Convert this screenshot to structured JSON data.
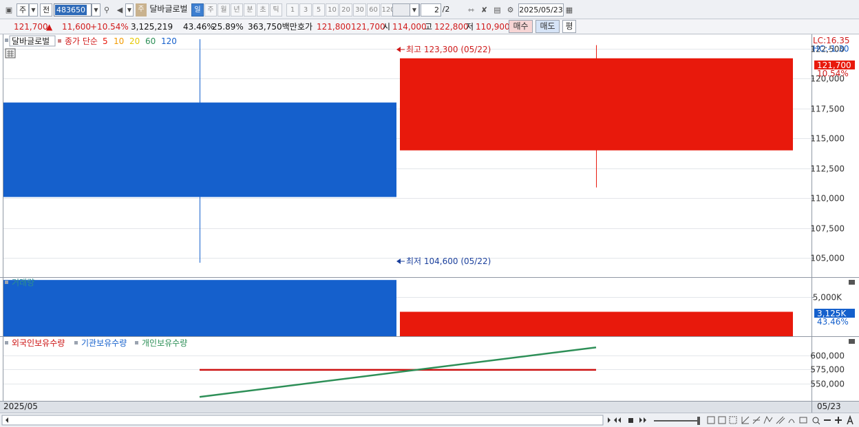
{
  "toolbar": {
    "market": "주",
    "prev": "전",
    "code": "483650",
    "stock_badge": "주",
    "stock_name": "달바글로벌",
    "periods": [
      "일",
      "주",
      "월",
      "년",
      "분",
      "초",
      "틱"
    ],
    "period_selected": 0,
    "intervals": [
      "1",
      "3",
      "5",
      "10",
      "20",
      "30",
      "60",
      "120"
    ],
    "page_current": "2",
    "page_total": "/2",
    "date": "2025/05/23"
  },
  "quote": {
    "price": "121,700",
    "arrow": "▲",
    "change": "11,600",
    "change_pct": "+10.54%",
    "volume": "3,125,219",
    "vol_ratio": "43.46%",
    "turnover": "25.89%",
    "amount": "363,750백만",
    "hoga_label": "호가",
    "ask": "121,800",
    "bid": "121,700",
    "open_label": "시",
    "open": "114,000",
    "high_label": "고",
    "high": "122,800",
    "low_label": "저",
    "low": "110,900",
    "buy_label": "매수",
    "sell_label": "매도",
    "eval_label": "평"
  },
  "colors": {
    "up": "#e8190c",
    "down": "#1560cc",
    "foreign": "#cc1010",
    "institution": "#1560cc",
    "individual": "#2d8f57",
    "grid": "#e3e6ea"
  },
  "price_panel": {
    "legend_name": "달바글로벌",
    "legend_ma": "종가 단순",
    "ma_periods": [
      {
        "label": "5",
        "color": "#e8190c"
      },
      {
        "label": "10",
        "color": "#f29a00"
      },
      {
        "label": "20",
        "color": "#e6c800"
      },
      {
        "label": "60",
        "color": "#2d8f57"
      },
      {
        "label": "120",
        "color": "#1560cc"
      }
    ],
    "lc_text": "LC:16.35",
    "hc_text": "HC:-1.30",
    "price_badge": "121,700",
    "pct_badge": "10.54%",
    "high_note": "최고 123,300 (05/22)",
    "low_note": "최저 104,600 (05/22)"
  },
  "volume_panel": {
    "title": "거래량",
    "value_badge": "3,125K",
    "pct_badge": "43.46%"
  },
  "holding_panel": {
    "legend": [
      "외국인보유수량",
      "기관보유수량",
      "개인보유수량"
    ]
  },
  "x_axis": {
    "left_label": "2025/05",
    "right_label": "05/23"
  },
  "chart_data": [
    {
      "type": "candlestick",
      "title": "",
      "x": [
        "05/22",
        "05/23"
      ],
      "series": [
        {
          "open": 118000,
          "high": 123300,
          "low": 104600,
          "close": 110100
        },
        {
          "open": 114000,
          "high": 122800,
          "low": 110900,
          "close": 121700
        }
      ],
      "ylim": [
        103400,
        123700
      ],
      "yticks": [
        105000,
        107500,
        110000,
        112500,
        115000,
        117500,
        120000,
        122500
      ],
      "ytick_labels": [
        "105,000",
        "107,500",
        "110,000",
        "112,500",
        "115,000",
        "117,500",
        "120,000",
        "122,500"
      ]
    },
    {
      "type": "bar",
      "title": "",
      "categories": [
        "05/22",
        "05/23"
      ],
      "values": [
        7190000,
        3125219
      ],
      "bar_colors": [
        "#1560cc",
        "#e8190c"
      ],
      "ylim": [
        0,
        7470000
      ],
      "yticks": [
        5000000
      ],
      "ytick_labels": [
        "5,000K"
      ]
    },
    {
      "type": "line",
      "title": "",
      "categories": [
        "05/22",
        "05/23"
      ],
      "series": [
        {
          "name": "외국인보유수량",
          "values": [
            574000,
            574000
          ],
          "color": "#cc1010"
        },
        {
          "name": "개인보유수량",
          "values": [
            526000,
            614000
          ],
          "color": "#2d8f57"
        }
      ],
      "ylim": [
        519000,
        632500
      ],
      "yticks": [
        550000,
        575000,
        600000
      ],
      "ytick_labels": [
        "550,000",
        "575,000",
        "600,000"
      ]
    }
  ]
}
